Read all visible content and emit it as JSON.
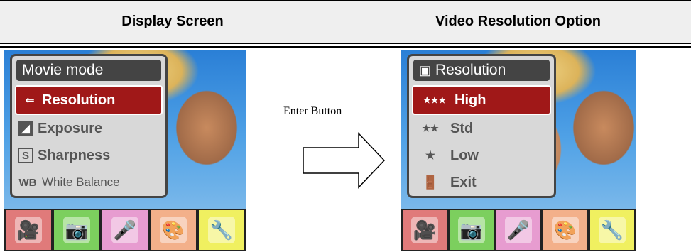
{
  "header": {
    "left_title": "Display Screen",
    "right_title": "Video Resolution Option"
  },
  "arrow": {
    "label": "Enter Button"
  },
  "left_screen": {
    "menu_title": "Movie mode",
    "items": [
      {
        "icon": "resolution-icon",
        "label": "Resolution",
        "selected": true
      },
      {
        "icon": "exposure-icon",
        "label": "Exposure",
        "selected": false
      },
      {
        "icon": "sharpness-icon",
        "icon_text": "S",
        "label": "Sharpness",
        "selected": false
      },
      {
        "icon": "white-balance-icon",
        "icon_text": "WB",
        "label": "White Balance",
        "selected": false
      }
    ]
  },
  "right_screen": {
    "menu_title": "Resolution",
    "items": [
      {
        "icon": "three-stars-icon",
        "label": "High",
        "selected": true
      },
      {
        "icon": "two-stars-icon",
        "label": "Std",
        "selected": false
      },
      {
        "icon": "star-icon",
        "label": "Low",
        "selected": false
      },
      {
        "icon": "exit-door-icon",
        "label": "Exit",
        "selected": false
      }
    ]
  },
  "tabs": [
    {
      "icon": "camcorder-icon",
      "color": "#e07a7a"
    },
    {
      "icon": "camera-icon",
      "color": "#7ccf5e"
    },
    {
      "icon": "microphone-icon",
      "color": "#e79cd0"
    },
    {
      "icon": "palette-icon",
      "color": "#f3b08a"
    },
    {
      "icon": "tools-icon",
      "color": "#f0f060"
    }
  ],
  "colors": {
    "selected": "#a01818",
    "menu_title_bg": "#444444",
    "menu_bg": "#d8d8d8"
  }
}
